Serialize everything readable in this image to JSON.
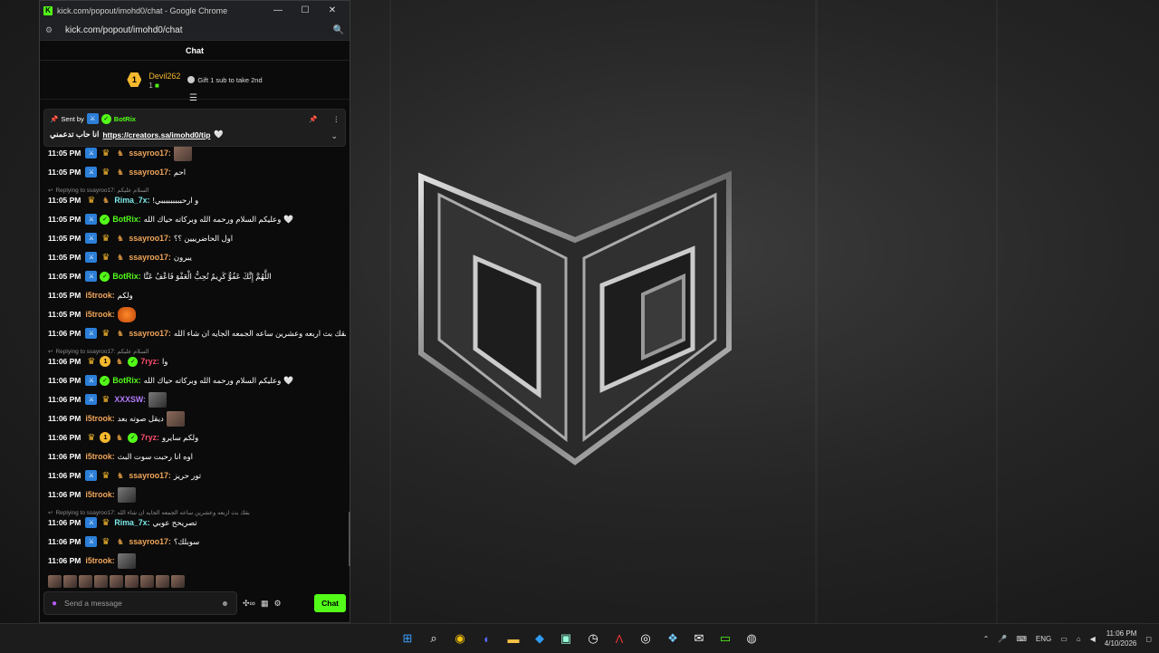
{
  "window": {
    "title": "kick.com/popout/imohd0/chat - Google Chrome",
    "url": "kick.com/popout/imohd0/chat",
    "minimize": "—",
    "maximize": "☐",
    "close": "✕"
  },
  "chat": {
    "header": "Chat",
    "gift": {
      "rank": "1",
      "username": "Devil262",
      "count": "1",
      "message": "Gift 1 sub to take 2nd"
    },
    "pinned": {
      "sent_by_label": "Sent by",
      "sender": "BotRix",
      "text": "انا حاب تدعمني",
      "link": "https://creators.sa/imohd0/tip"
    },
    "messages": [
      {
        "time": "11:05 PM",
        "badges": [
          "mod",
          "crown",
          "wolf"
        ],
        "user": "ssayroo17:",
        "color": "#f2a65a",
        "text": "",
        "emote": "emote"
      },
      {
        "time": "11:05 PM",
        "badges": [
          "mod",
          "crown",
          "wolf"
        ],
        "user": "ssayroo17:",
        "color": "#f2a65a",
        "text": "احم",
        "emote": ""
      },
      {
        "time": "11:05 PM",
        "badges": [
          "crown",
          "wolf"
        ],
        "user": "Rima_7x:",
        "color": "#7de8e8",
        "text": "و ارحبببببببببي!",
        "emote": "",
        "reply": "Replying to ssayroo17: السلام عليكم"
      },
      {
        "time": "11:05 PM",
        "badges": [
          "mod",
          "ver"
        ],
        "user": "BotRix:",
        "color": "#53fc18",
        "text": "وعليكم السلام ورحمه الله وبركاته حياك الله",
        "emote": "heart"
      },
      {
        "time": "11:05 PM",
        "badges": [
          "mod",
          "crown",
          "wolf"
        ],
        "user": "ssayroo17:",
        "color": "#f2a65a",
        "text": "اول الحاضرييين ؟؟",
        "emote": ""
      },
      {
        "time": "11:05 PM",
        "badges": [
          "mod",
          "crown",
          "wolf"
        ],
        "user": "ssayroo17:",
        "color": "#f2a65a",
        "text": "يبرون",
        "emote": ""
      },
      {
        "time": "11:05 PM",
        "badges": [
          "mod",
          "ver"
        ],
        "user": "BotRix:",
        "color": "#53fc18",
        "text": "اللَّهُمَّ إِنَّكَ عَفُوٌّ كَرِيمٌ تُحِبُّ الْعَفْوَ فَاعْفُ عَنَّا",
        "emote": ""
      },
      {
        "time": "11:05 PM",
        "badges": [],
        "user": "i5trook:",
        "color": "#f2a65a",
        "text": "ولكم",
        "emote": ""
      },
      {
        "time": "11:05 PM",
        "badges": [],
        "user": "i5trook:",
        "color": "#f2a65a",
        "text": "",
        "emote": "orange"
      },
      {
        "time": "11:06 PM",
        "badges": [
          "mod",
          "crown",
          "wolf"
        ],
        "user": "ssayroo17:",
        "color": "#f2a65a",
        "text": "بقك بث اربعه وعشرين ساعه الجمعه الجايه ان شاء الله",
        "emote": ""
      },
      {
        "time": "11:06 PM",
        "badges": [
          "crown",
          "one",
          "wolf",
          "ver"
        ],
        "user": "7ryz:",
        "color": "#ff4d6d",
        "text": "وا",
        "emote": "",
        "reply": "Replying to ssayroo17: السلام عليكم"
      },
      {
        "time": "11:06 PM",
        "badges": [
          "mod",
          "ver"
        ],
        "user": "BotRix:",
        "color": "#53fc18",
        "text": "وعليكم السلام ورحمه الله وبركاته حياك الله",
        "emote": "heart"
      },
      {
        "time": "11:06 PM",
        "badges": [
          "mod",
          "crown"
        ],
        "user": "XXXSW:",
        "color": "#b57cff",
        "text": "",
        "emote": "dark"
      },
      {
        "time": "11:06 PM",
        "badges": [],
        "user": "i5trook:",
        "color": "#f2a65a",
        "text": "ديقل صوته بعد",
        "emote": "emote"
      },
      {
        "time": "11:06 PM",
        "badges": [
          "crown",
          "one",
          "wolf",
          "ver"
        ],
        "user": "7ryz:",
        "color": "#ff4d6d",
        "text": "ولكم سايرو",
        "emote": ""
      },
      {
        "time": "11:06 PM",
        "badges": [],
        "user": "i5trook:",
        "color": "#f2a65a",
        "text": "اوه انا رحبت سوت البث",
        "emote": ""
      },
      {
        "time": "11:06 PM",
        "badges": [
          "mod",
          "crown",
          "wolf"
        ],
        "user": "ssayroo17:",
        "color": "#f2a65a",
        "text": "تور حريز",
        "emote": ""
      },
      {
        "time": "11:06 PM",
        "badges": [],
        "user": "i5trook:",
        "color": "#f2a65a",
        "text": "",
        "emote": "dark"
      },
      {
        "time": "11:06 PM",
        "badges": [
          "mod",
          "crown"
        ],
        "user": "Rima_7x:",
        "color": "#7de8e8",
        "text": "تصريحح عوبي",
        "emote": "",
        "reply": "Replying to ssayroo17: بقك بث اربعه وعشرين ساعه الجمعه الجايه ان شاء الله"
      },
      {
        "time": "11:06 PM",
        "badges": [
          "mod",
          "crown",
          "wolf"
        ],
        "user": "ssayroo17:",
        "color": "#f2a65a",
        "text": "سوبلك؟",
        "emote": ""
      },
      {
        "time": "11:06 PM",
        "badges": [],
        "user": "i5trook:",
        "color": "#f2a65a",
        "text": "",
        "emote": "dark"
      }
    ],
    "input_placeholder": "Send a message",
    "send_label": "Chat"
  },
  "taskbar": {
    "lang": "ENG",
    "time": "11:06 PM",
    "date": "4/10/2026"
  }
}
